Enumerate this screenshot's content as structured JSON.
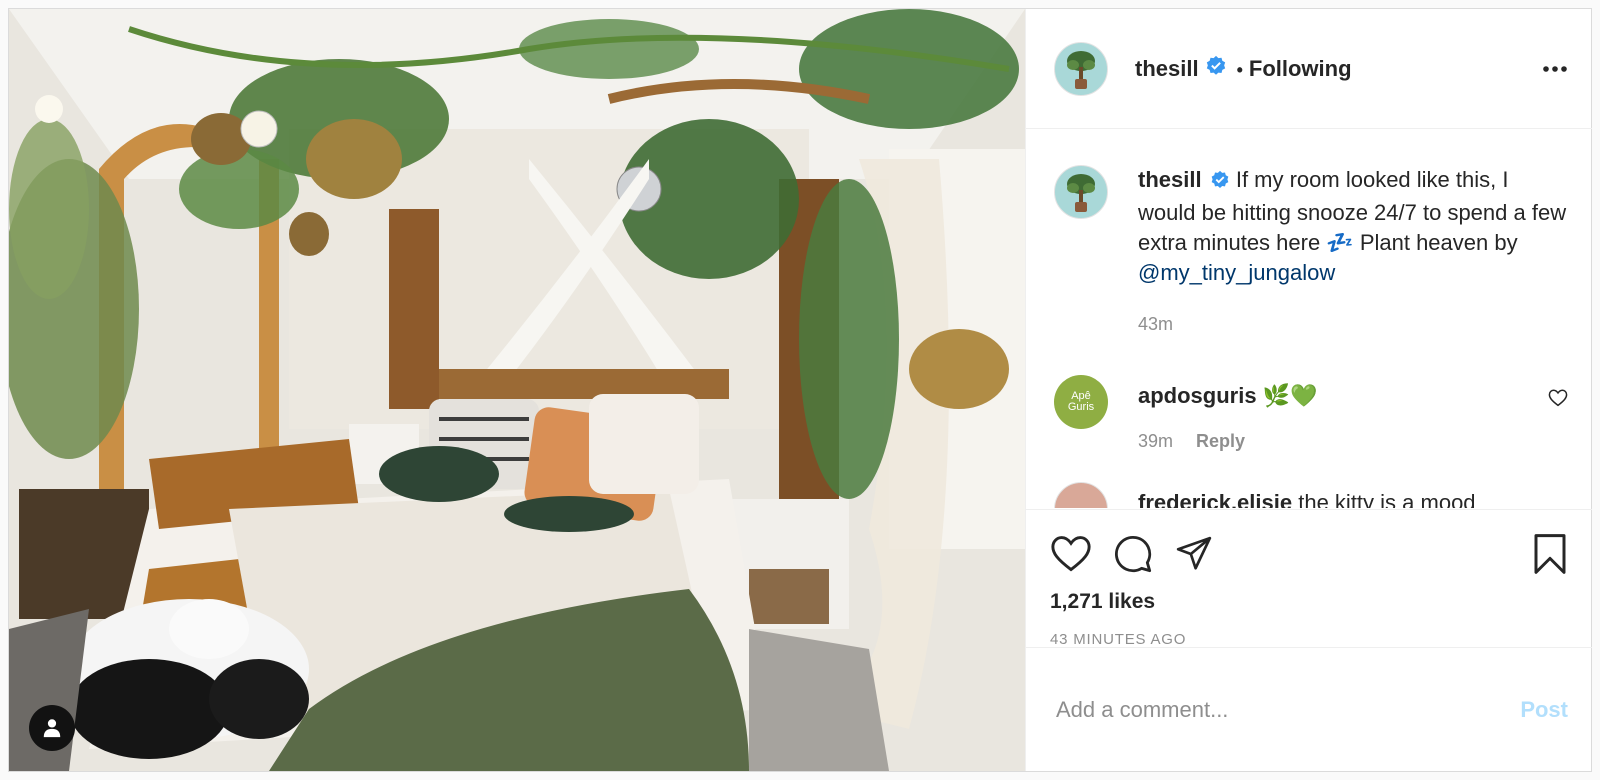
{
  "post": {
    "username": "thesill",
    "follow_status": "Following",
    "caption": {
      "username": "thesill",
      "text": "If my room looked like this, I would be hitting snooze 24/7 to spend a few extra minutes here 💤 Plant heaven by",
      "mention": "@my_tiny_jungalow",
      "time": "43m"
    },
    "comments": [
      {
        "username": "apdosguris",
        "text": "🌿💚",
        "avatar_text": "Apê\nGuris",
        "time": "39m",
        "reply_label": "Reply"
      },
      {
        "username": "frederick.elisie",
        "text": "the kitty is a mood"
      }
    ],
    "likes": "1,271 likes",
    "time_ago": "43 MINUTES AGO",
    "add_comment_placeholder": "Add a comment...",
    "post_button": "Post"
  },
  "icons": {
    "like": "heart-icon",
    "comment": "comment-icon",
    "share": "paper-plane-icon",
    "save": "bookmark-icon",
    "more": "more-dots-icon",
    "verified": "verified-badge-icon",
    "user_tag": "user-tag-icon"
  },
  "colors": {
    "verified": "#3897f0",
    "mention": "#00376b",
    "post_disabled": "#b2dffc",
    "secondary_text": "#8e8e8e"
  }
}
